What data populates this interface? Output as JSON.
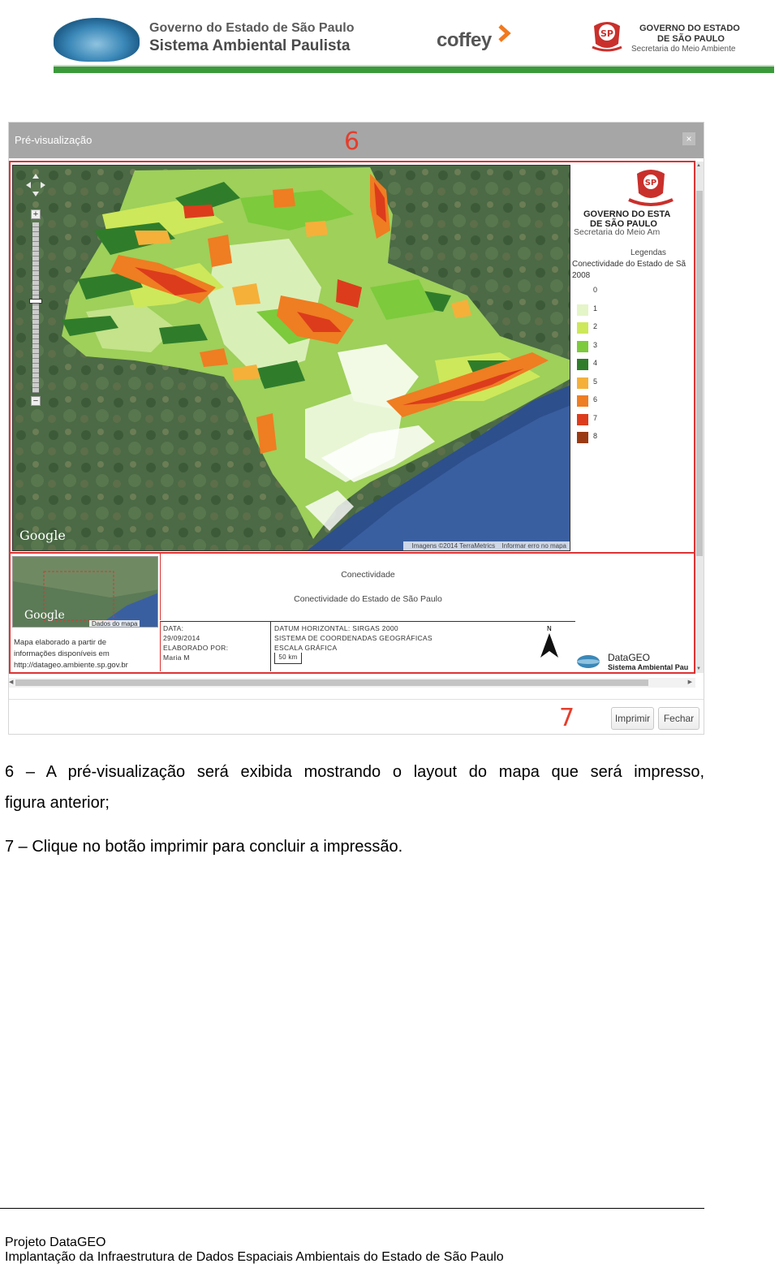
{
  "header": {
    "title_line1": "Governo do Estado de São Paulo",
    "title_line2": "Sistema Ambiental Paulista",
    "coffey": "coffey",
    "gov_line1": "GOVERNO DO ESTADO",
    "gov_line2": "DE SÃO PAULO",
    "gov_line3": "Secretaria do Meio Ambiente",
    "bar_color": "#3a9a3a"
  },
  "dialog": {
    "title": "Pré-visualização",
    "close_label": "×",
    "step_marker_6": "6",
    "step_marker_7": "7",
    "print_button": "Imprimir",
    "close_button": "Fechar"
  },
  "map": {
    "google": "Google",
    "credit_images": "Imagens ©2014 TerraMetrics",
    "credit_report": "Informar erro no mapa",
    "zoom_in": "+",
    "zoom_out": "−"
  },
  "legend": {
    "gov_line1": "GOVERNO DO ESTA",
    "gov_line2": "DE SÃO PAULO",
    "gov_line3": "Secretaria do Meio Am",
    "title": "Legendas",
    "subtitle1": "Conectividade do Estado de Sã",
    "subtitle2": "2008",
    "items": [
      {
        "label": "0",
        "color": "#ffffff"
      },
      {
        "label": "1",
        "color": "#e4f5c8"
      },
      {
        "label": "2",
        "color": "#cde85a"
      },
      {
        "label": "3",
        "color": "#7dca3c"
      },
      {
        "label": "4",
        "color": "#2f7d2b"
      },
      {
        "label": "5",
        "color": "#f5b03a"
      },
      {
        "label": "6",
        "color": "#ef7d22"
      },
      {
        "label": "7",
        "color": "#dc3c1c"
      },
      {
        "label": "8",
        "color": "#9a3a14"
      }
    ]
  },
  "layout_box": {
    "overview_google": "Google",
    "overview_data": "Dados do mapa",
    "note_line1": "Mapa elaborado a partir de",
    "note_line2": "informações disponíveis em",
    "note_line3": "http://datageo.ambiente.sp.gov.br",
    "title1": "Conectividade",
    "title2": "Conectividade do Estado de São Paulo",
    "meta_line1": "DATA:",
    "meta_line2": "29/09/2014",
    "meta_line3": "ELABORADO POR:",
    "meta_line4": "Maria M",
    "datum_line1": "DATUM HORIZONTAL: SIRGAS 2000",
    "datum_line2": "SISTEMA DE COORDENADAS GEOGRÁFICAS",
    "datum_line3": "ESCALA GRÁFICA",
    "scale": "50 km",
    "north": "N",
    "datageo_line1": "DataGEO",
    "datageo_line2": "Sistema Ambiental Pau"
  },
  "body": {
    "para1_line1": "6 – A pré-visualização será exibida mostrando o layout do mapa que será impresso,",
    "para1_line2": "figura anterior;",
    "para2": "7 – Clique no botão imprimir para concluir a impressão."
  },
  "footer": {
    "line1": "Projeto DataGEO",
    "line2": "Implantação da Infraestrutura de Dados Espaciais Ambientais do Estado de São Paulo"
  }
}
